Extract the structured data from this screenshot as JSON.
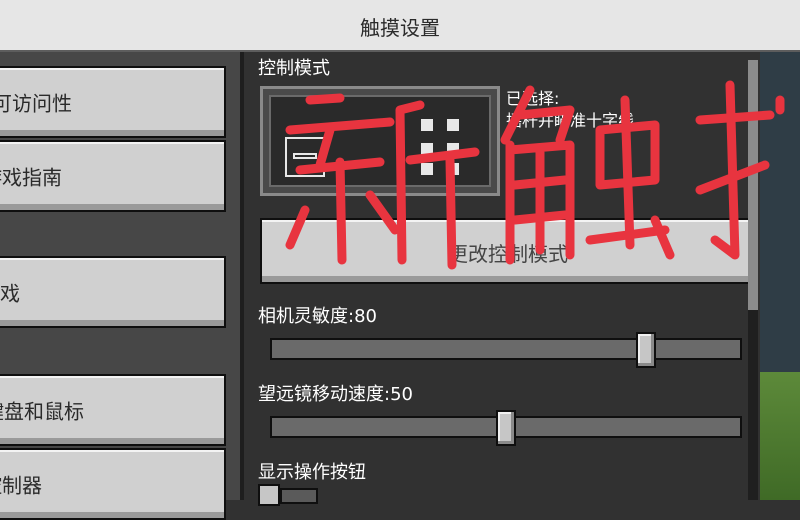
{
  "header": {
    "title": "触摸设置"
  },
  "sidebar": {
    "items": [
      {
        "label": "可访问性"
      },
      {
        "label": "游戏指南"
      },
      {
        "label": "游戏"
      },
      {
        "label": "键盘和鼠标"
      },
      {
        "label": "控制器"
      }
    ]
  },
  "main": {
    "control_mode_label": "控制模式",
    "selected_label": "已选择:",
    "selected_value": "摇杆并瞄准十字线",
    "change_button_label": "更改控制模式",
    "camera_sensitivity": {
      "label": "相机灵敏度:80",
      "value": 80,
      "max": 100
    },
    "spyglass_speed": {
      "label": "望远镜移动速度:50",
      "value": 50,
      "max": 100
    },
    "show_action_buttons_label": "显示操作按钮"
  },
  "overlay": {
    "text": "新触控",
    "color": "#e8343f"
  }
}
